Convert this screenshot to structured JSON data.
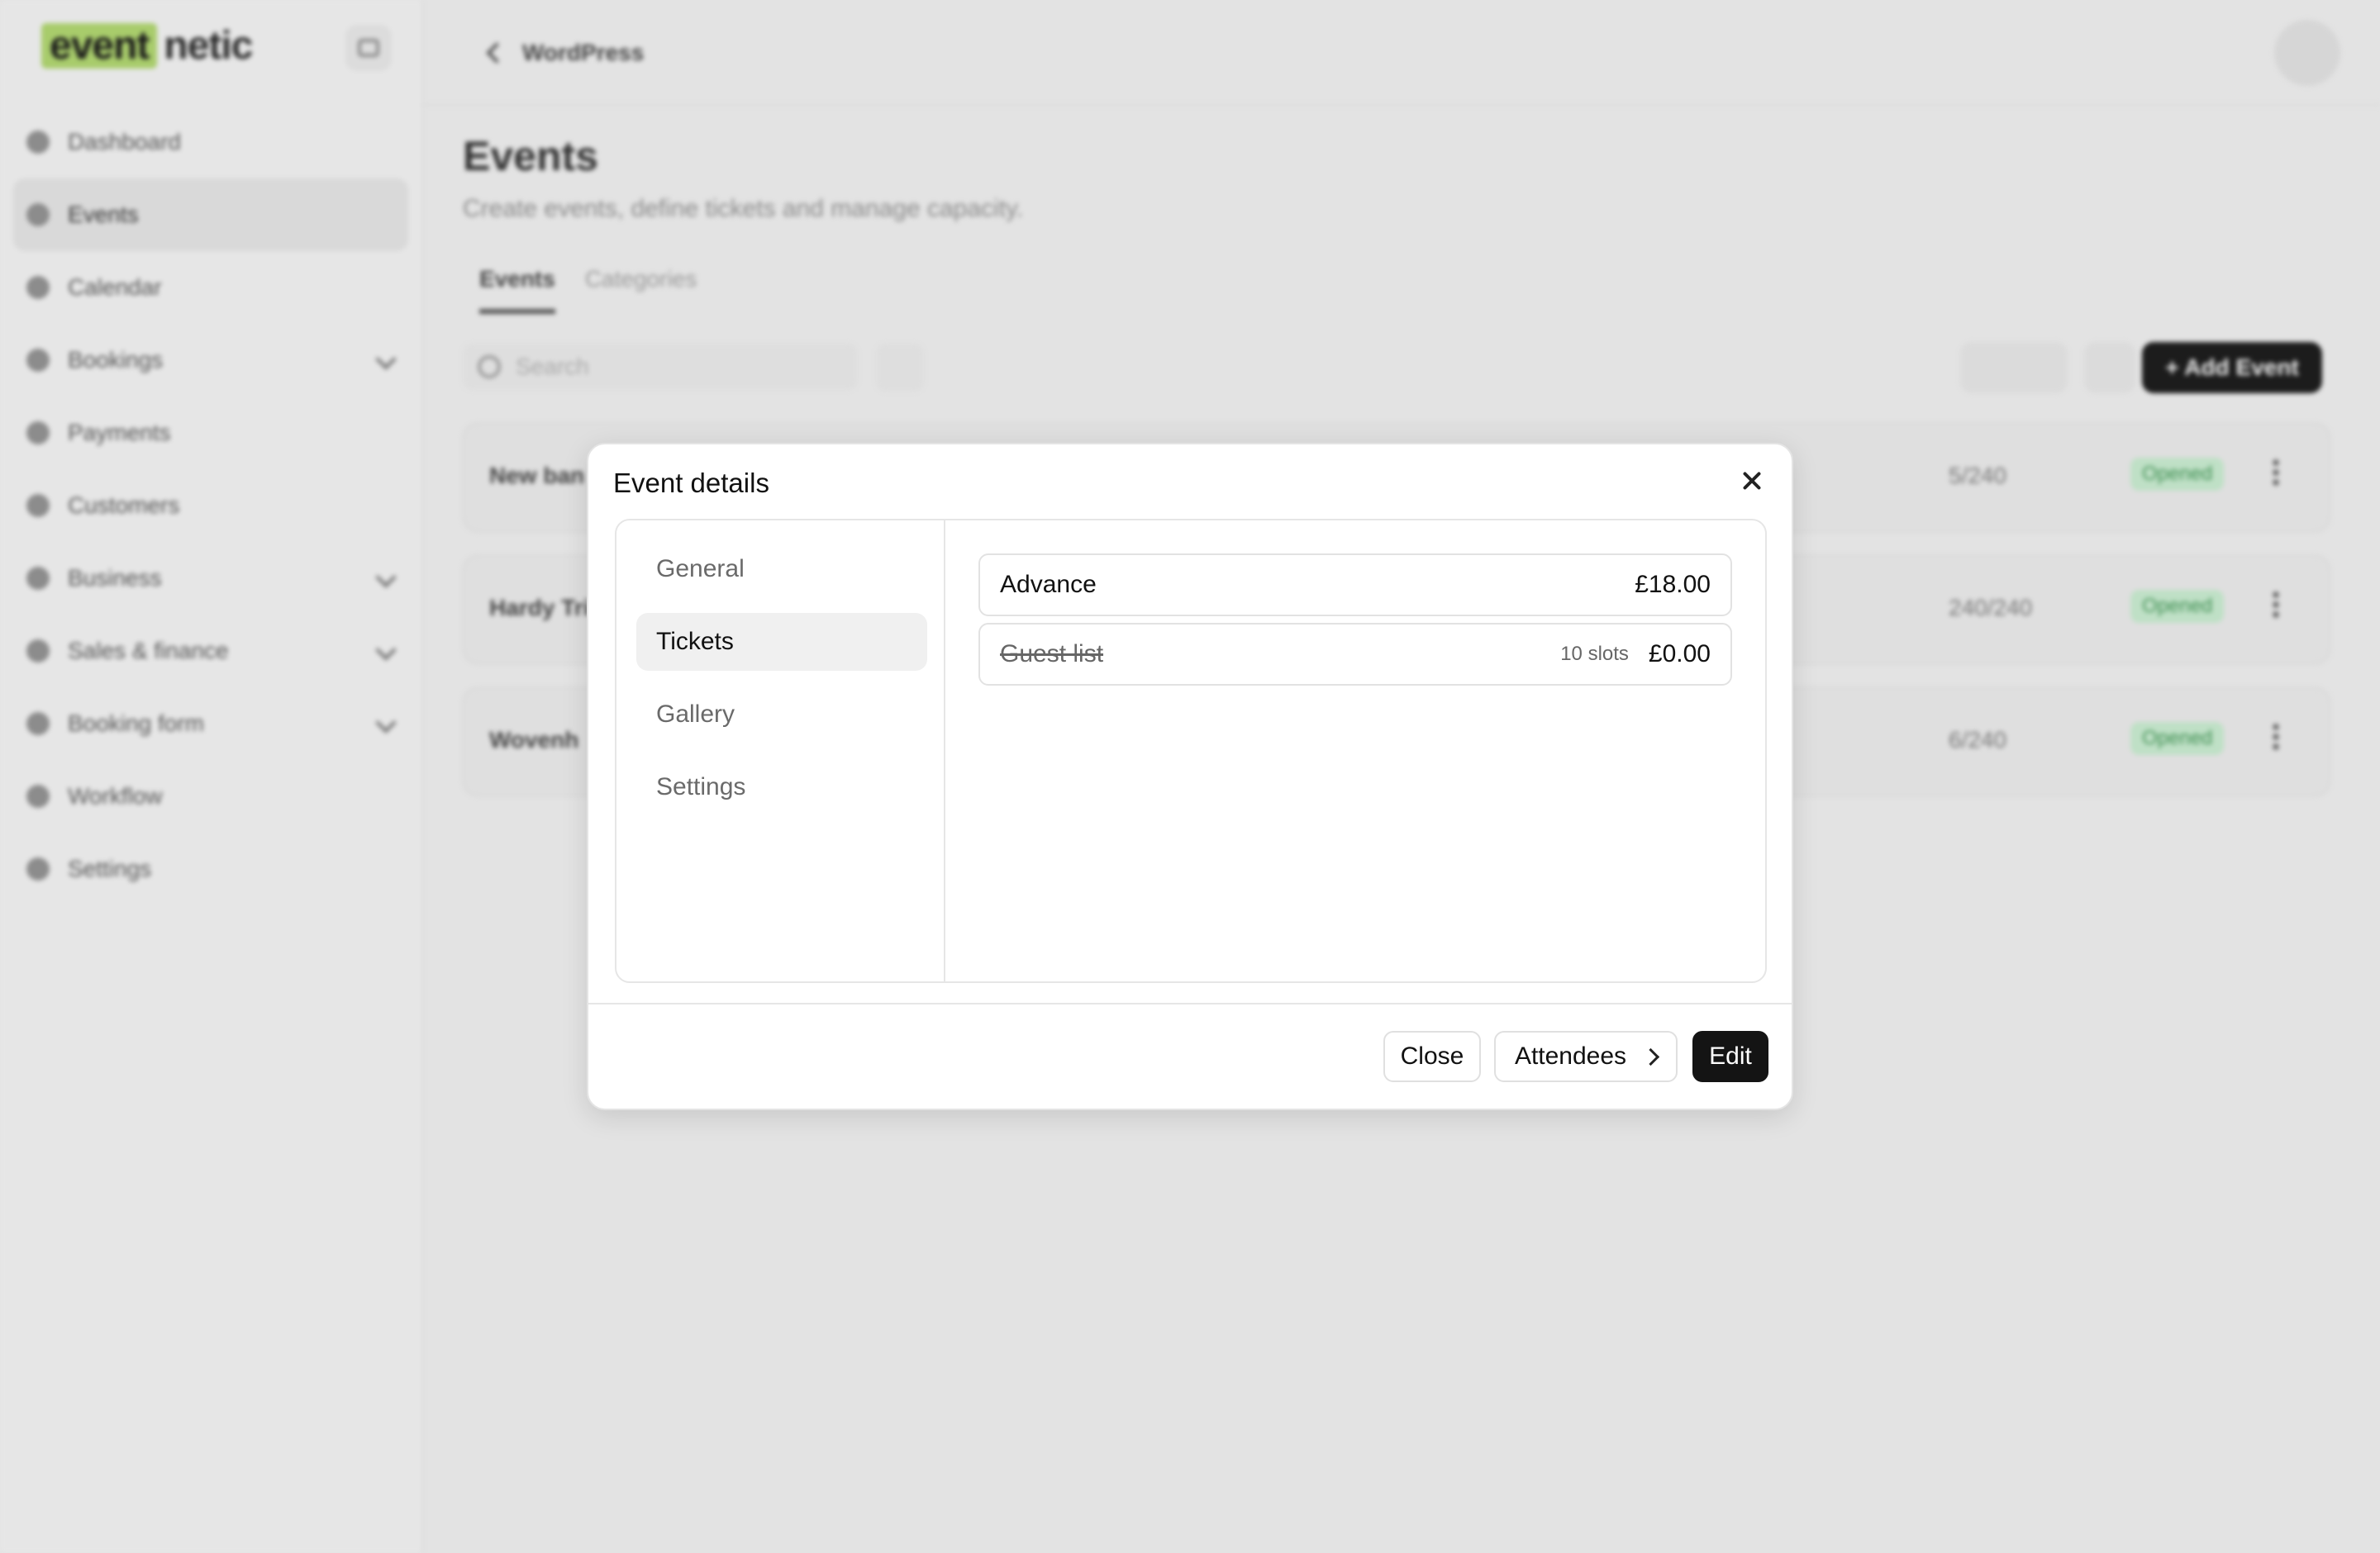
{
  "app": {
    "logo": {
      "highlight": "event",
      "rest": "netic"
    },
    "breadcrumb_back": "WordPress",
    "sidebar": {
      "items": [
        {
          "label": "Dashboard",
          "icon": "dashboard-icon"
        },
        {
          "label": "Events",
          "icon": "calendar-box-icon",
          "active": true
        },
        {
          "label": "Calendar",
          "icon": "calendar-icon"
        },
        {
          "label": "Bookings",
          "icon": "bookings-icon",
          "expandable": true
        },
        {
          "label": "Payments",
          "icon": "payments-icon"
        },
        {
          "label": "Customers",
          "icon": "customers-icon"
        },
        {
          "label": "Business",
          "icon": "business-icon",
          "expandable": true
        },
        {
          "label": "Sales & finance",
          "icon": "sales-icon",
          "expandable": true
        },
        {
          "label": "Booking form",
          "icon": "form-icon",
          "expandable": true
        },
        {
          "label": "Workflow",
          "icon": "workflow-icon"
        },
        {
          "label": "Settings",
          "icon": "gear-icon"
        }
      ]
    },
    "page": {
      "title": "Events",
      "subtitle": "Create events, define tickets and manage capacity.",
      "tabs": [
        "Events",
        "Categories"
      ],
      "search_placeholder": "Search",
      "add_button": "+ Add Event",
      "rows": [
        {
          "name": "New ban",
          "capacity": "5/240",
          "status": "Opened"
        },
        {
          "name": "Hardy Tri",
          "capacity": "240/240",
          "status": "Opened"
        },
        {
          "name": "Wovenh",
          "capacity": "6/240",
          "status": "Opened"
        }
      ]
    }
  },
  "modal": {
    "title": "Event details",
    "tabs": [
      "General",
      "Tickets",
      "Gallery",
      "Settings"
    ],
    "active_tab": "Tickets",
    "tickets": [
      {
        "name": "Advance",
        "slots": "",
        "price": "£18.00",
        "disabled": false
      },
      {
        "name": "Guest list",
        "slots": "10 slots",
        "price": "£0.00",
        "disabled": true
      }
    ],
    "buttons": {
      "close": "Close",
      "attendees": "Attendees",
      "edit": "Edit"
    }
  },
  "colors": {
    "accent": "#141414",
    "logo_highlight": "#a8cc6b",
    "status_opened": "#3f8f52"
  }
}
